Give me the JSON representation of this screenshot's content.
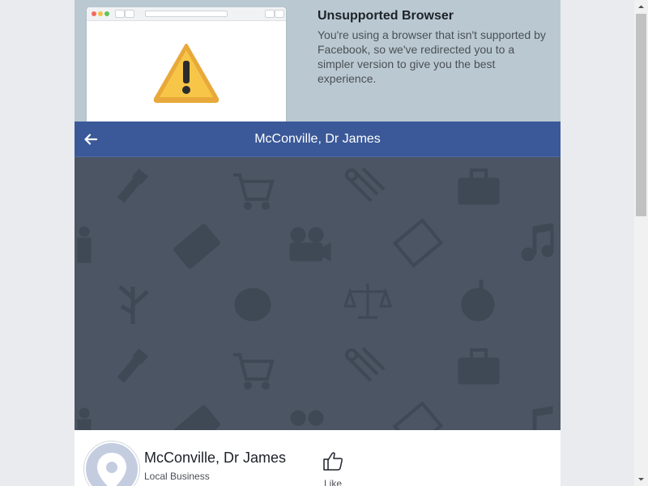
{
  "banner": {
    "title": "Unsupported Browser",
    "text": "You're using a browser that isn't supported by Facebook, so we've redirected you to a simpler version to give you the best experience."
  },
  "header": {
    "back_icon": "back-arrow-icon",
    "title": "McConville, Dr James"
  },
  "page": {
    "name": "McConville, Dr James",
    "category": "Local Business",
    "like_label": "Like",
    "avatar_icon": "location-pin-icon"
  },
  "colors": {
    "header_bg": "#3b5998",
    "banner_bg": "#bac9d1",
    "cover_bg": "#4b5563",
    "warning": "#f7c648"
  }
}
